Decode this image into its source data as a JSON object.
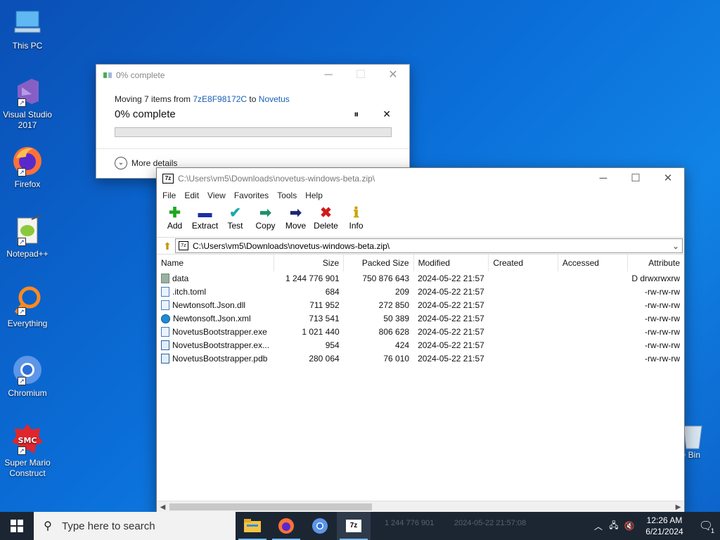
{
  "desktop": {
    "icons": [
      {
        "label": "This PC",
        "icon": "computer-icon"
      },
      {
        "label": "Visual Studio 2017",
        "icon": "visual-studio-icon"
      },
      {
        "label": "Firefox",
        "icon": "firefox-icon"
      },
      {
        "label": "Notepad++",
        "icon": "notepadpp-icon"
      },
      {
        "label": "Everything",
        "icon": "everything-search-icon"
      },
      {
        "label": "Chromium",
        "icon": "chromium-icon"
      },
      {
        "label": "Super Mario Construct",
        "icon": "smc-icon"
      }
    ],
    "recycle_label": "cle Bin"
  },
  "progress_dialog": {
    "title": "0% complete",
    "moving_prefix": "Moving 7 items from ",
    "source": "7zE8F98172C",
    "to": " to ",
    "destination": "Novetus",
    "percent_text": "0% complete",
    "progress": 0.0,
    "more_details": "More details",
    "accent": "#06b025"
  },
  "zip_window": {
    "title": "C:\\Users\\vm5\\Downloads\\novetus-windows-beta.zip\\",
    "menu": [
      "File",
      "Edit",
      "View",
      "Favorites",
      "Tools",
      "Help"
    ],
    "toolbar": [
      {
        "label": "Add",
        "icon": "plus-icon",
        "color": "#1fa81f"
      },
      {
        "label": "Extract",
        "icon": "minus-icon",
        "color": "#1b2fa8"
      },
      {
        "label": "Test",
        "icon": "check-icon",
        "color": "#19a9a9"
      },
      {
        "label": "Copy",
        "icon": "copy-arrow-icon",
        "color": "#1d8f6b"
      },
      {
        "label": "Move",
        "icon": "move-arrow-icon",
        "color": "#1b2570"
      },
      {
        "label": "Delete",
        "icon": "delete-x-icon",
        "color": "#d31a1a"
      },
      {
        "label": "Info",
        "icon": "info-icon",
        "color": "#c9a400"
      }
    ],
    "address": "C:\\Users\\vm5\\Downloads\\novetus-windows-beta.zip\\",
    "columns": [
      "Name",
      "Size",
      "Packed Size",
      "Modified",
      "Created",
      "Accessed",
      "Attribute"
    ],
    "rows": [
      {
        "name": "data",
        "size": "1 244 776 901",
        "packed": "750 876 643",
        "modified": "2024-05-22 21:57",
        "created": "",
        "accessed": "",
        "attr": "D drwxrwxrw",
        "icon": "folder"
      },
      {
        "name": ".itch.toml",
        "size": "684",
        "packed": "209",
        "modified": "2024-05-22 21:57",
        "created": "",
        "accessed": "",
        "attr": "-rw-rw-rw",
        "icon": "file"
      },
      {
        "name": "Newtonsoft.Json.dll",
        "size": "711 952",
        "packed": "272 850",
        "modified": "2024-05-22 21:57",
        "created": "",
        "accessed": "",
        "attr": "-rw-rw-rw",
        "icon": "file"
      },
      {
        "name": "Newtonsoft.Json.xml",
        "size": "713 541",
        "packed": "50 389",
        "modified": "2024-05-22 21:57",
        "created": "",
        "accessed": "",
        "attr": "-rw-rw-rw",
        "icon": "edge"
      },
      {
        "name": "NovetusBootstrapper.exe",
        "size": "1 021 440",
        "packed": "806 628",
        "modified": "2024-05-22 21:57",
        "created": "",
        "accessed": "",
        "attr": "-rw-rw-rw",
        "icon": "file"
      },
      {
        "name": "NovetusBootstrapper.ex...",
        "size": "954",
        "packed": "424",
        "modified": "2024-05-22 21:57",
        "created": "",
        "accessed": "",
        "attr": "-rw-rw-rw",
        "icon": "exe"
      },
      {
        "name": "NovetusBootstrapper.pdb",
        "size": "280 064",
        "packed": "76 010",
        "modified": "2024-05-22 21:57",
        "created": "",
        "accessed": "",
        "attr": "-rw-rw-rw",
        "icon": "exe"
      }
    ]
  },
  "taskbar": {
    "search_placeholder": "Type here to search",
    "apps": [
      "file-explorer-icon",
      "firefox-icon",
      "chromium-icon",
      "7zip-icon"
    ],
    "ghost_size": "1 244 776 901",
    "ghost_date": "2024-05-22 21:57:08",
    "time": "12:26 AM",
    "date": "6/21/2024",
    "notification_count": "1"
  }
}
